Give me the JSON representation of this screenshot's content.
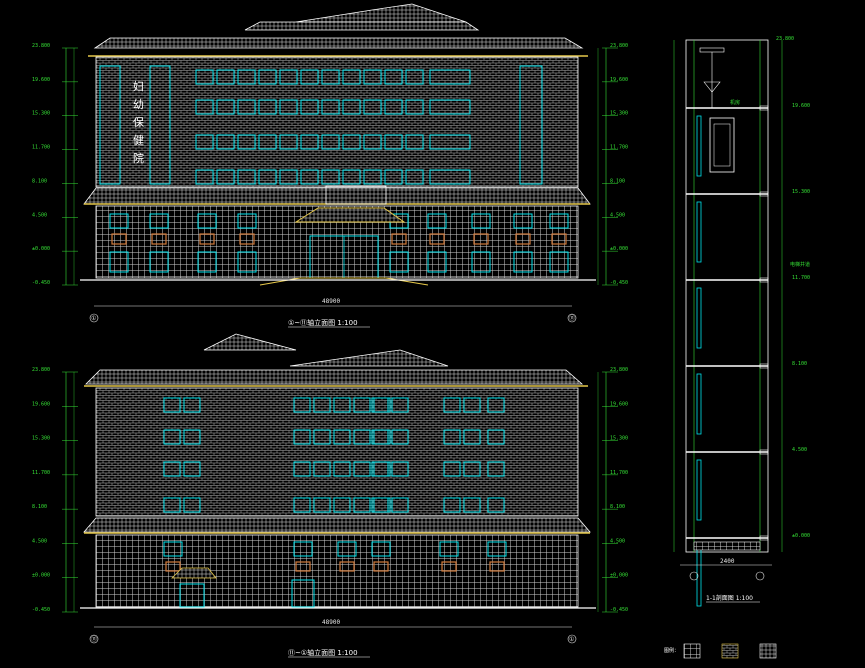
{
  "drawing": {
    "front_elevation": {
      "title": "①~⑪轴立面图 1:100",
      "overall_dim": "48900",
      "sign_chars": [
        "妇",
        "幼",
        "保",
        "健",
        "院"
      ],
      "axis_start": "①",
      "axis_end": "⑪",
      "left_levels": [
        "23.800",
        "19.600",
        "15.300",
        "11.700",
        "8.100",
        "4.500",
        "±0.000",
        "-0.450"
      ],
      "right_levels": [
        "23.800",
        "19.600",
        "15.300",
        "11.700",
        "8.100",
        "4.500",
        "±0.000",
        "-0.450"
      ]
    },
    "rear_elevation": {
      "title": "⑪~①轴立面图 1:100",
      "overall_dim": "48900",
      "axis_start": "⑪",
      "axis_end": "①",
      "left_levels": [
        "23.800",
        "19.600",
        "15.300",
        "11.700",
        "8.100",
        "4.500",
        "±0.000",
        "-0.450"
      ],
      "right_levels": [
        "23.800",
        "19.600",
        "15.300",
        "11.700",
        "8.100",
        "4.500",
        "±0.000",
        "-0.450"
      ]
    },
    "section": {
      "title": "1-1剖面图 1:100",
      "top_level": "23.800",
      "roof_note": "机房",
      "floor_levels": [
        "19.600",
        "15.300",
        "11.700",
        "8.100",
        "4.500",
        "±0.000"
      ],
      "side_note": "电梯井道",
      "bottom_dims": [
        "2400"
      ]
    },
    "legend": {
      "title": "图例："
    },
    "colors": {
      "background": "#000000",
      "wall_line": "#e8e8e8",
      "window": "#00e5ee",
      "roof": "#f0f0f0",
      "eave": "#e6c84a",
      "dimension": "#35e035",
      "accent": "#d27a3a",
      "label": "#ffffff"
    }
  }
}
